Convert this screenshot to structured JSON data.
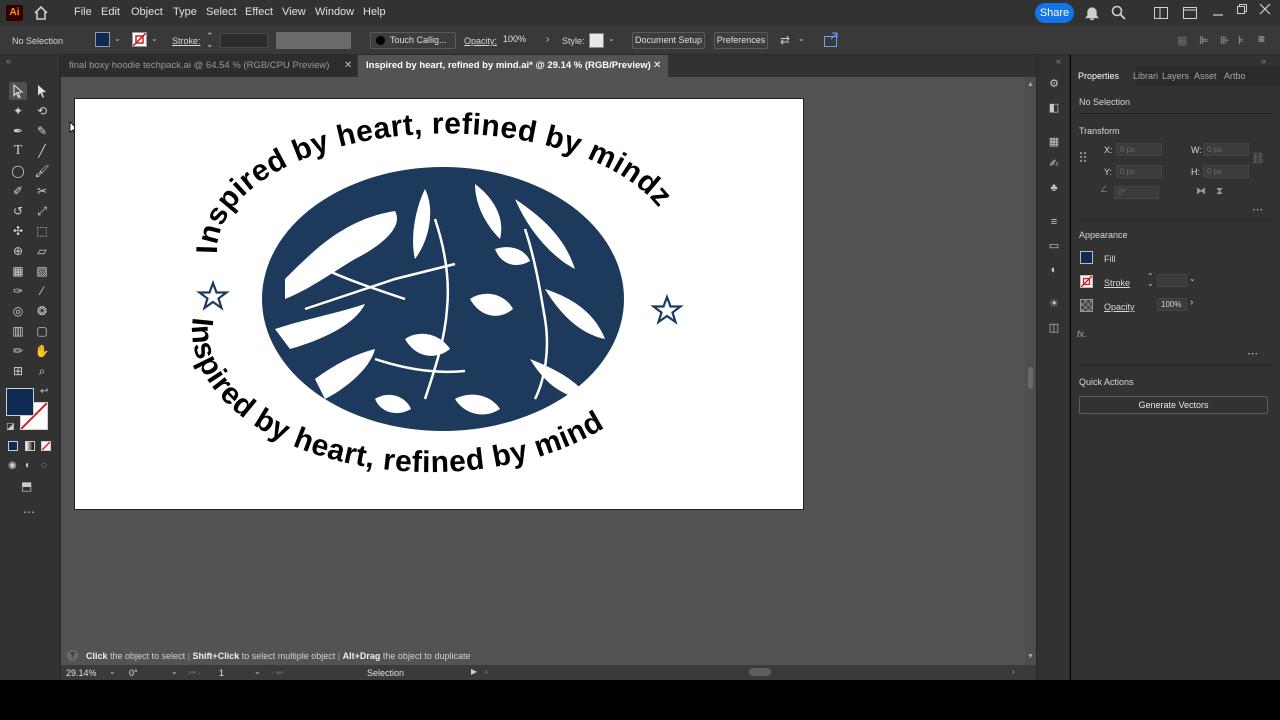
{
  "app": {
    "logo": "Ai",
    "menu": [
      "File",
      "Edit",
      "Object",
      "Type",
      "Select",
      "Effect",
      "View",
      "Window",
      "Help"
    ],
    "share_label": "Share",
    "icons": [
      "home-icon",
      "bell-icon",
      "search-icon",
      "workspace-icon",
      "window-icon",
      "minimize-icon",
      "maximize-icon",
      "close-icon"
    ]
  },
  "control_bar": {
    "selection_status": "No Selection",
    "stroke_label": "Stroke:",
    "brush_name": "Touch Callig...",
    "opacity_label": "Opacity:",
    "opacity_value": "100%",
    "style_label": "Style:",
    "document_setup_label": "Document Setup",
    "preferences_label": "Preferences"
  },
  "tabs": [
    {
      "label": "final boxy hoodie techpack.ai @ 64.54 % (RGB/CPU Preview)",
      "active": false
    },
    {
      "label": "Inspired by heart, refined by mind.ai* @ 29.14 % (RGB/Preview)",
      "active": true
    }
  ],
  "artwork": {
    "top_text": "Inspired by heart, refined by mindz",
    "bottom_text": "Inspired by heart, refined by mind",
    "ink_color": "#1d3a5c"
  },
  "status_hint": {
    "click": "Click",
    "click_text": "the object to select",
    "shift": "Shift+Click",
    "shift_text": "to select multiple object",
    "alt": "Alt+Drag",
    "alt_text": "the object to duplicate"
  },
  "status_bar": {
    "zoom": "29.14%",
    "rotation": "0°",
    "artboard": "1",
    "tool": "Selection"
  },
  "properties": {
    "tabs": [
      "Properties",
      "Librari",
      "Layers",
      "Asset",
      "Artbo"
    ],
    "selection": "No Selection",
    "transform_title": "Transform",
    "x_label": "X:",
    "y_label": "Y:",
    "w_label": "W:",
    "h_label": "H:",
    "x_val": "0 px",
    "y_val": "0 px",
    "w_val": "0 px",
    "h_val": "0 px",
    "angle_val": "0°",
    "appearance_title": "Appearance",
    "fill_label": "Fill",
    "stroke_label": "Stroke",
    "opacity_label": "Opacity",
    "opacity_value": "100%",
    "fx_label": "fx.",
    "quick_actions_title": "Quick Actions",
    "generate_vectors_label": "Generate Vectors"
  },
  "colors": {
    "fill": "#0d2b52",
    "accent": "#1473e6",
    "stroke_none": "#cc2222"
  }
}
